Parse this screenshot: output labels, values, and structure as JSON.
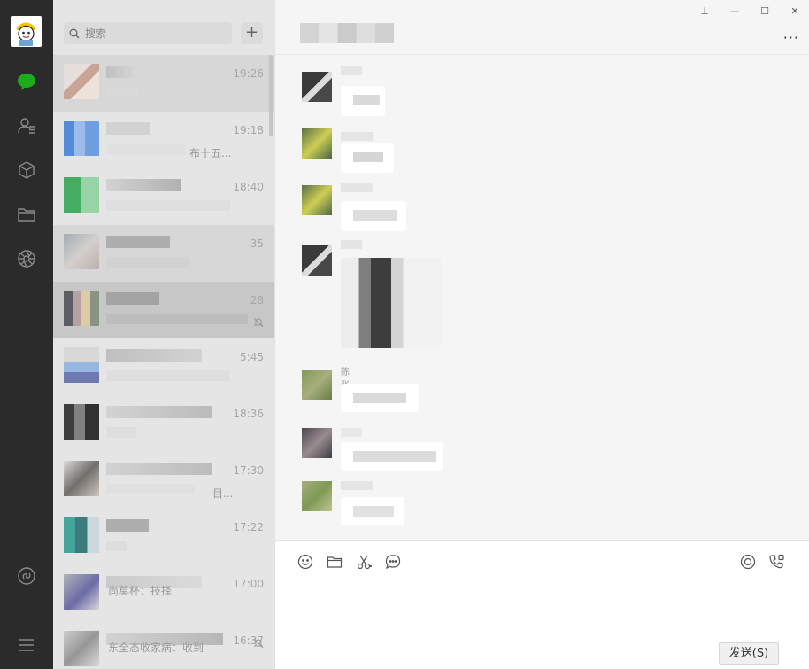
{
  "search": {
    "placeholder": "搜索",
    "add_label": "+"
  },
  "chats": [
    {
      "time": "19:26",
      "snippet": ""
    },
    {
      "time": "19:18",
      "snippet": "布十五..."
    },
    {
      "time": "18:40",
      "snippet": ""
    },
    {
      "time": "35",
      "snippet": ""
    },
    {
      "time": "28",
      "snippet": ""
    },
    {
      "time": "5:45",
      "snippet": ""
    },
    {
      "time": "18:36",
      "snippet": ""
    },
    {
      "time": "17:30",
      "snippet": "目..."
    },
    {
      "time": "17:22",
      "snippet": ""
    },
    {
      "time": "17:00",
      "snippet": "尚莫杯：技择"
    },
    {
      "time": "16:37",
      "snippet": "东全态收家病：收到"
    }
  ],
  "window": {
    "more": "···",
    "pin": "⊥",
    "minimize": "—",
    "maximize": "☐",
    "close": "✕"
  },
  "message": {
    "sender_partial": "陈张"
  },
  "input": {
    "send_label": "发送(S)"
  },
  "colors": {
    "rail": "#2b2b2b",
    "accent": "#1aad19",
    "list_bg": "#e6e5e5",
    "active_row": "#c8c7c7"
  }
}
